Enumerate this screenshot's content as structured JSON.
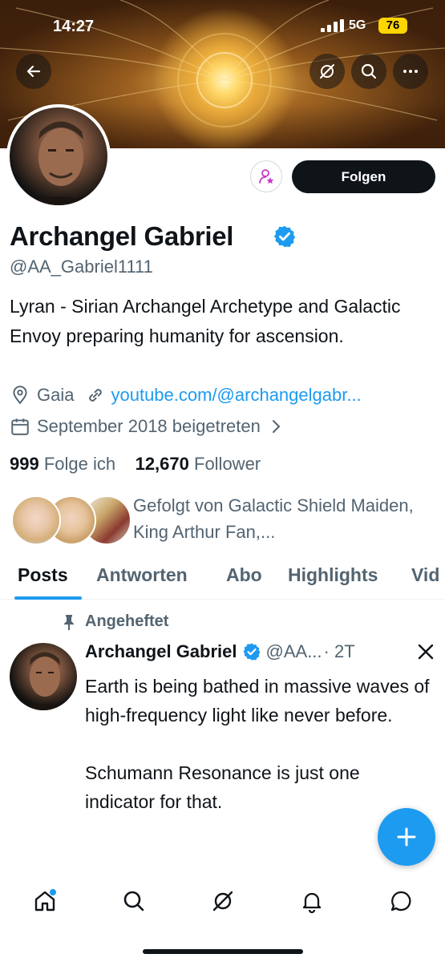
{
  "status_bar": {
    "time": "14:27",
    "network": "5G",
    "battery": "76"
  },
  "header": {
    "icons": [
      "back-arrow-icon",
      "grok-icon",
      "search-icon",
      "more-icon"
    ]
  },
  "profile": {
    "name": "Archangel Gabriel",
    "handle": "@AA_Gabriel1111",
    "bio": "Lyran - Sirian Archangel Archetype and Galactic Envoy preparing humanity for ascension.",
    "location": "Gaia",
    "website": "youtube.com/@archangelgabr...",
    "joined": "September 2018 beigetreten",
    "following_count": "999",
    "following_label": "Folge ich",
    "followers_count": "12,670",
    "followers_label": "Follower",
    "followed_by": "Gefolgt von Galactic Shield Maiden, King Arthur Fan,...",
    "follow_button": "Folgen"
  },
  "tabs": [
    {
      "label": "Posts",
      "active": true
    },
    {
      "label": "Antworten",
      "active": false
    },
    {
      "label": "Abo",
      "active": false
    },
    {
      "label": "Highlights",
      "active": false
    },
    {
      "label": "Vid",
      "active": false
    }
  ],
  "pinned_post": {
    "pinned_label": "Angeheftet",
    "author": "Archangel Gabriel",
    "handle": "@AA...",
    "time": "· 2T",
    "text": "Earth is being bathed in massive waves of high-frequency light like never before.\n\nSchumann Resonance is just one indicator for that."
  },
  "colors": {
    "accent": "#1d9bf0",
    "text": "#0f1419",
    "secondary": "#536471"
  }
}
